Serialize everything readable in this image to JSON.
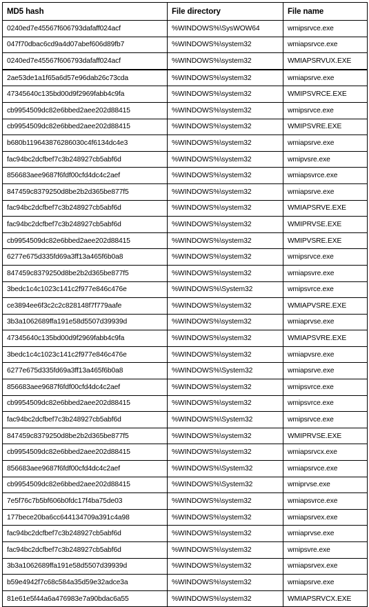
{
  "table": {
    "headers": {
      "md5": "MD5 hash",
      "directory": "File directory",
      "filename": "File name"
    },
    "rows": [
      {
        "md5": "0240ed7e45567f606793dafaff024acf",
        "directory": "%WINDOWS%\\SysWOW64",
        "filename": "wmipsrvce.exe",
        "thick_top": false
      },
      {
        "md5": "047f70dbac6cd9a4d07abef606d89fb7",
        "directory": "%WINDOWS%\\system32",
        "filename": "wmiapsrvce.exe",
        "thick_top": false
      },
      {
        "md5": "0240ed7e45567f606793dafaff024acf",
        "directory": "%WINDOWS%\\system32",
        "filename": "WMIAPSRVUX.EXE",
        "thick_top": false
      },
      {
        "md5": "2ae53de1a1f65a6d57e96dab26c73cda",
        "directory": "%WINDOWS%\\system32",
        "filename": "wmiapsrve.exe",
        "thick_top": true
      },
      {
        "md5": "47345640c135bd00d9f2969fabb4c9fa",
        "directory": "%WINDOWS%\\system32",
        "filename": "WMIPSVRCE.EXE",
        "thick_top": false
      },
      {
        "md5": "cb9954509dc82e6bbed2aee202d88415",
        "directory": "%WINDOWS%\\system32",
        "filename": "wmipsrvce.exe",
        "thick_top": false
      },
      {
        "md5": "cb9954509dc82e6bbed2aee202d88415",
        "directory": "%WINDOWS%\\system32",
        "filename": "WMIPSVRE.EXE",
        "thick_top": false
      },
      {
        "md5": "b680b119643876286030c4f6134dc4e3",
        "directory": "%WINDOWS%\\system32",
        "filename": "wmiapsrve.exe",
        "thick_top": false
      },
      {
        "md5": "fac94bc2dcfbef7c3b248927cb5abf6d",
        "directory": "%WINDOWS%\\system32",
        "filename": "wmipvsre.exe",
        "thick_top": false
      },
      {
        "md5": "856683aee9687f6fdf00cfd4dc4c2aef",
        "directory": "%WINDOWS%\\system32",
        "filename": "wmiapsvrce.exe",
        "thick_top": false
      },
      {
        "md5": "847459c8379250d8be2b2d365be877f5",
        "directory": "%WINDOWS%\\system32",
        "filename": "wmiapsrve.exe",
        "thick_top": false
      },
      {
        "md5": "fac94bc2dcfbef7c3b248927cb5abf6d",
        "directory": "%WINDOWS%\\system32",
        "filename": "WMIAPSRVE.EXE",
        "thick_top": false
      },
      {
        "md5": "fac94bc2dcfbef7c3b248927cb5abf6d",
        "directory": "%WINDOWS%\\system32",
        "filename": "WMIPRVSE.EXE",
        "thick_top": false
      },
      {
        "md5": "cb9954509dc82e6bbed2aee202d88415",
        "directory": "%WINDOWS%\\system32",
        "filename": "WMIPVSRE.EXE",
        "thick_top": false
      },
      {
        "md5": "6277e675d335fd69a3ff13a465f6b0a8",
        "directory": "%WINDOWS%\\system32",
        "filename": "wmipsrvce.exe",
        "thick_top": false
      },
      {
        "md5": "847459c8379250d8be2b2d365be877f5",
        "directory": "%WINDOWS%\\system32",
        "filename": "wmiapsvre.exe",
        "thick_top": false
      },
      {
        "md5": "3bedc1c4c1023c141c2f977e846c476e",
        "directory": "%WINDOWS%\\System32",
        "filename": "wmipsvrce.exe",
        "thick_top": false
      },
      {
        "md5": "ce3894ee6f3c2c2c828148f7f779aafe",
        "directory": "%WINDOWS%\\system32",
        "filename": "WMIAPVSRE.EXE",
        "thick_top": false
      },
      {
        "md5": "3b3a1062689ffa191e58d5507d39939d",
        "directory": "%WINDOWS%\\system32",
        "filename": "wmiaprvse.exe",
        "thick_top": false
      },
      {
        "md5": "47345640c135bd00d9f2969fabb4c9fa",
        "directory": "%WINDOWS%\\system32",
        "filename": "WMIAPSVRE.EXE",
        "thick_top": false
      },
      {
        "md5": "3bedc1c4c1023c141c2f977e846c476e",
        "directory": "%WINDOWS%\\system32",
        "filename": "wmiapvsre.exe",
        "thick_top": false
      },
      {
        "md5": "6277e675d335fd69a3ff13a465f6b0a8",
        "directory": "%WINDOWS%\\System32",
        "filename": "wmiapsrve.exe",
        "thick_top": false
      },
      {
        "md5": "856683aee9687f6fdf00cfd4dc4c2aef",
        "directory": "%WINDOWS%\\system32",
        "filename": "wmipsvrce.exe",
        "thick_top": false
      },
      {
        "md5": "cb9954509dc82e6bbed2aee202d88415",
        "directory": "%WINDOWS%\\system32",
        "filename": "wmipsvrce.exe",
        "thick_top": false
      },
      {
        "md5": "fac94bc2dcfbef7c3b248927cb5abf6d",
        "directory": "%WINDOWS%\\System32",
        "filename": "wmipsrvce.exe",
        "thick_top": false
      },
      {
        "md5": "847459c8379250d8be2b2d365be877f5",
        "directory": "%WINDOWS%\\system32",
        "filename": "WMIPRVSE.EXE",
        "thick_top": false
      },
      {
        "md5": "cb9954509dc82e6bbed2aee202d88415",
        "directory": "%WINDOWS%\\system32",
        "filename": "wmiapsrvcx.exe",
        "thick_top": false
      },
      {
        "md5": "856683aee9687f6fdf00cfd4dc4c2aef",
        "directory": "%WINDOWS%\\System32",
        "filename": "wmiapsrvce.exe",
        "thick_top": false
      },
      {
        "md5": "cb9954509dc82e6bbed2aee202d88415",
        "directory": "%WINDOWS%\\System32",
        "filename": "wmiprvse.exe",
        "thick_top": false
      },
      {
        "md5": "7e5f76c7b5bf606b0fdc17f4ba75de03",
        "directory": "%WINDOWS%\\system32",
        "filename": "wmiapsvrce.exe",
        "thick_top": false
      },
      {
        "md5": "177bece20ba6cc644134709a391c4a98",
        "directory": "%WINDOWS%\\system32",
        "filename": "wmiapsrvex.exe",
        "thick_top": false
      },
      {
        "md5": "fac94bc2dcfbef7c3b248927cb5abf6d",
        "directory": "%WINDOWS%\\system32",
        "filename": "wmiaprvse.exe",
        "thick_top": false
      },
      {
        "md5": "fac94bc2dcfbef7c3b248927cb5abf6d",
        "directory": "%WINDOWS%\\system32",
        "filename": "wmipsvre.exe",
        "thick_top": false
      },
      {
        "md5": "3b3a1062689ffa191e58d5507d39939d",
        "directory": "%WINDOWS%\\system32",
        "filename": "wmiapsrvex.exe",
        "thick_top": false
      },
      {
        "md5": "b59e4942f7c68c584a35d59e32adce3a",
        "directory": "%WINDOWS%\\system32",
        "filename": "wmiapsrve.exe",
        "thick_top": false
      },
      {
        "md5": "81e61e5f44a6a476983e7a90bdac6a55",
        "directory": "%WINDOWS%\\system32",
        "filename": "WMIAPSRVCX.EXE",
        "thick_top": false
      }
    ]
  }
}
